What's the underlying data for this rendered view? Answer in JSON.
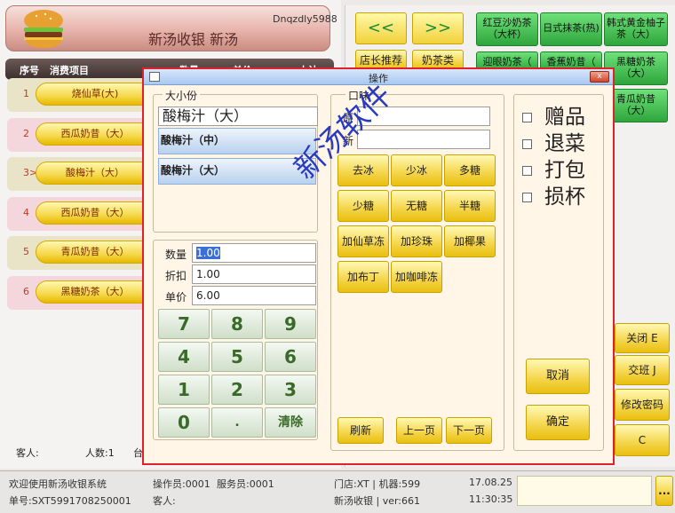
{
  "header": {
    "app_title": "新汤收银   新汤",
    "device_id": "Dnqzdly5988"
  },
  "order_columns": {
    "seq": "序号",
    "item": "消费项目",
    "qty": "数量",
    "price": "单价",
    "amount": "小计"
  },
  "order_rows": [
    {
      "index": "1",
      "name": "烧仙草(大)"
    },
    {
      "index": "2",
      "name": "西瓜奶昔（大）"
    },
    {
      "index": "3>",
      "name": "酸梅汁（大）"
    },
    {
      "index": "4",
      "name": "西瓜奶昔（大）"
    },
    {
      "index": "5",
      "name": "青瓜奶昔（大）"
    },
    {
      "index": "6",
      "name": "黑糖奶茶（大）"
    }
  ],
  "order_footer": {
    "guest_label": "客人:",
    "count_label": "人数:1",
    "table_label": "台"
  },
  "right_nav": {
    "prev": "<<",
    "next": ">>"
  },
  "categories": [
    "店长推荐",
    "奶茶类"
  ],
  "products": [
    "红豆沙奶茶（大杯）",
    "日式抹茶(热)",
    "韩式黄金柚子茶（大）",
    "迎眼奶茶（",
    "香蕉奶昔（",
    "黑糖奶茶（大）",
    "青瓜奶昔（大）"
  ],
  "right_actions": {
    "close": "关闭 E",
    "shift": "交班 J",
    "change_password": "修改密码",
    "c": "C"
  },
  "dialog": {
    "title": "操作",
    "close": "x",
    "size_group": "大小份",
    "current_size": "酸梅汁（大）",
    "size_options": [
      "酸梅汁（中）",
      "酸梅汁（大）"
    ],
    "qty_label": "数量",
    "qty_value": "1.00",
    "discount_label": "折扣",
    "discount_value": "1.00",
    "price_label": "单价",
    "price_value": "6.00",
    "keypad": [
      "7",
      "8",
      "9",
      "4",
      "5",
      "6",
      "1",
      "2",
      "3",
      "0",
      ".",
      "清除"
    ],
    "flavor_group": "口味",
    "orig_label": "原",
    "orig_value": "",
    "new_label": "新",
    "new_value": "",
    "flavors": [
      "去冰",
      "少冰",
      "多糖",
      "少糖",
      "无糖",
      "半糖",
      "加仙草冻",
      "加珍珠",
      "加椰果",
      "加布丁",
      "加咖啡冻"
    ],
    "refresh": "刷新",
    "prev_page": "上一页",
    "next_page": "下一页",
    "options": [
      "赠品",
      "退菜",
      "打包",
      "损杯"
    ],
    "cancel": "取消",
    "confirm": "确定"
  },
  "watermark": "新汤软件",
  "footer": {
    "welcome": "欢迎使用新汤收银系统",
    "operator": "操作员:0001",
    "waiter": "服务员:0001",
    "store": "门店:XT | 机器:599",
    "date": "17.08.25",
    "order_no": "单号:SXT5991708250001",
    "guest": "客人:",
    "version": "新汤收银 | ver:661",
    "time": "11:30:35",
    "more": "..."
  }
}
